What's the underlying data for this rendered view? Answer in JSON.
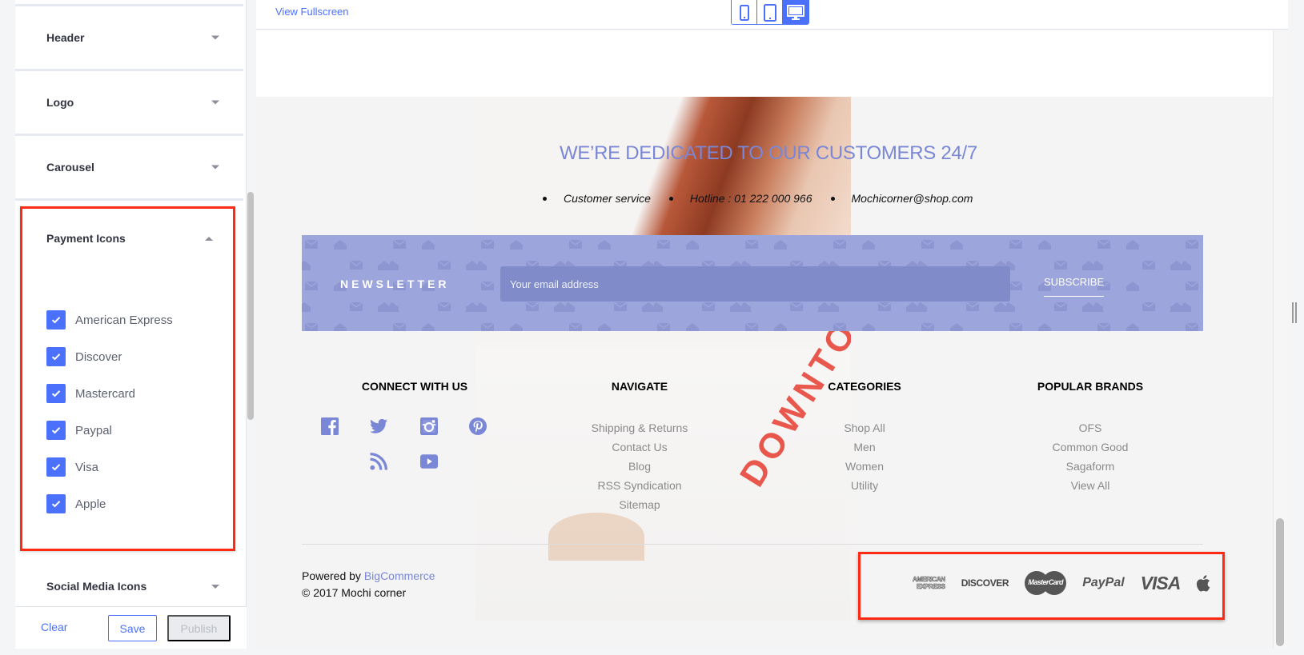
{
  "sidebar": {
    "sections": [
      {
        "label": "Header",
        "expanded": false
      },
      {
        "label": "Logo",
        "expanded": false
      },
      {
        "label": "Carousel",
        "expanded": false
      }
    ],
    "payment_section": {
      "label": "Payment Icons",
      "expanded": true,
      "options": [
        {
          "label": "American Express",
          "checked": true
        },
        {
          "label": "Discover",
          "checked": true
        },
        {
          "label": "Mastercard",
          "checked": true
        },
        {
          "label": "Paypal",
          "checked": true
        },
        {
          "label": "Visa",
          "checked": true
        },
        {
          "label": "Apple",
          "checked": true
        }
      ]
    },
    "social_section": {
      "label": "Social Media Icons",
      "expanded": false
    },
    "footer": {
      "clear_label": "Clear",
      "save_label": "Save",
      "publish_label": "Publish"
    }
  },
  "preview": {
    "view_fullscreen_label": "View Fullscreen",
    "device_modes": [
      {
        "name": "mobile",
        "active": false
      },
      {
        "name": "tablet",
        "active": false
      },
      {
        "name": "desktop",
        "active": true
      }
    ],
    "colors": {
      "accent": "#4b71fc",
      "brand": "#7a87d6",
      "highlight": "#ff2a14",
      "newsletter_bg": "#9ca5dc"
    }
  },
  "store": {
    "headline": "WE’RE DEDICATED TO OUR CUSTOMERS 24/7",
    "contact": [
      "Customer service",
      "Hotline : 01 222 000 966",
      "Mochicorner@shop.com"
    ],
    "photo_text": "DOWNTOWN",
    "newsletter": {
      "title": "NEWSLETTER",
      "placeholder": "Your email address",
      "subscribe_label": "SUBSCRIBE"
    },
    "columns": {
      "connect": {
        "title": "CONNECT WITH US",
        "icons": [
          "facebook-icon",
          "twitter-icon",
          "instagram-icon",
          "pinterest-icon",
          "rss-icon",
          "youtube-icon"
        ]
      },
      "navigate": {
        "title": "NAVIGATE",
        "links": [
          "Shipping & Returns",
          "Contact Us",
          "Blog",
          "RSS Syndication",
          "Sitemap"
        ]
      },
      "categories": {
        "title": "CATEGORIES",
        "links": [
          "Shop All",
          "Men",
          "Women",
          "Utility"
        ]
      },
      "brands": {
        "title": "POPULAR BRANDS",
        "links": [
          "OFS",
          "Common Good",
          "Sagaform",
          "View All"
        ]
      }
    },
    "powered_by_prefix": "Powered by ",
    "powered_by_link": "BigCommerce",
    "copyright": "© 2017 Mochi corner",
    "payment_icons": {
      "amex_line1": "AMERICAN",
      "amex_line2": "EXPRESS",
      "discover": "DISCOVER",
      "mastercard": "MasterCard",
      "paypal": "PayPal",
      "visa": "VISA",
      "apple": "apple-icon"
    }
  }
}
